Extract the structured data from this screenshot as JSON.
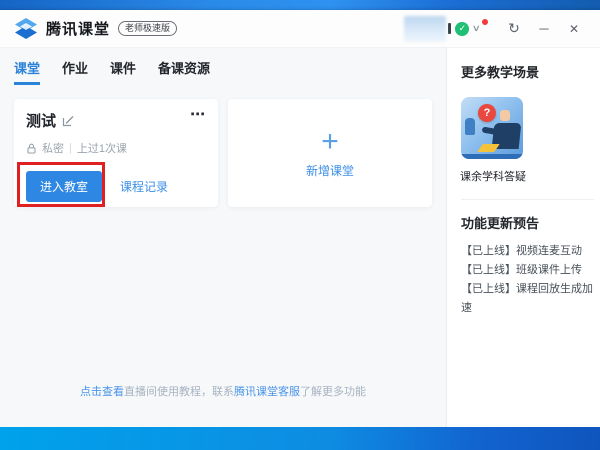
{
  "titlebar": {
    "app_title": "腾讯课堂",
    "edition_badge": "老师极速版",
    "verify_check": "✓",
    "chevron": "∨",
    "refresh": "↻",
    "minimize": "─",
    "close": "✕"
  },
  "tabs": [
    {
      "label": "课堂",
      "active": true
    },
    {
      "label": "作业",
      "active": false
    },
    {
      "label": "课件",
      "active": false
    },
    {
      "label": "备课资源",
      "active": false
    }
  ],
  "classroom_card": {
    "title": "测试",
    "more": "⋯",
    "privacy": "私密",
    "separator": "|",
    "lesson_count": "上过1次课",
    "enter_button": "进入教室",
    "records_link": "课程记录"
  },
  "new_classroom_card": {
    "plus": "+",
    "label": "新增课堂"
  },
  "tip": {
    "link1": "点击查看",
    "text1": "直播间使用教程，联系",
    "link2": "腾讯课堂客服",
    "text2": "了解更多功能"
  },
  "sidebar": {
    "scenes_title": "更多教学场景",
    "tile_badge": "?",
    "tile_caption": "课余学科答疑",
    "updates_title": "功能更新预告",
    "updates": [
      "【已上线】视频连麦互动",
      "【已上线】班级课件上传",
      "【已上线】课程回放生成加速"
    ]
  },
  "colors": {
    "accent_blue": "#2b82d9",
    "button_blue": "#2e87e2",
    "link_blue": "#3a8ee6",
    "highlight_red": "#e02020",
    "verify_green": "#1fbf75",
    "notification_red": "#f23a3a"
  }
}
